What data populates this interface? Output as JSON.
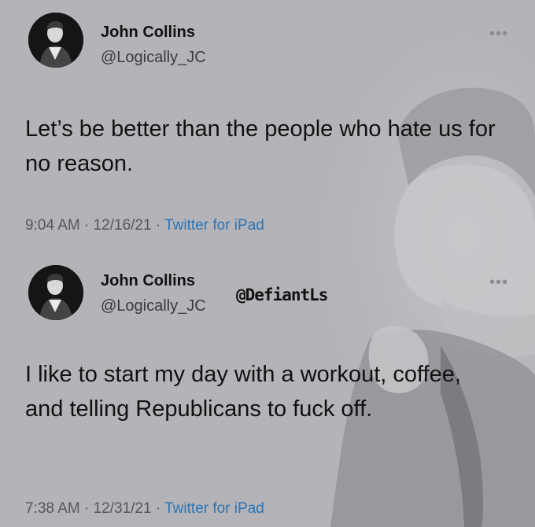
{
  "tweets": [
    {
      "author_name": "John Collins",
      "author_handle": "@Logically_JC",
      "text": "Let’s be better than the people who hate us for no reason.",
      "time": "9:04 AM",
      "date": "12/16/21",
      "source": "Twitter for iPad",
      "separator": " · "
    },
    {
      "author_name": "John Collins",
      "author_handle": "@Logically_JC",
      "text": "I like to start my day with a workout, coffee, and telling Republicans to fuck off.",
      "time": "7:38 AM",
      "date": "12/31/21",
      "source": "Twitter for iPad",
      "separator": " · "
    }
  ],
  "watermark": "@DefiantLs",
  "icons": {
    "more": "more-options-icon",
    "avatar": "avatar"
  },
  "colors": {
    "background": "#b4b4b8",
    "text": "#111111",
    "secondary": "#55555a",
    "link": "#2a74b5"
  }
}
